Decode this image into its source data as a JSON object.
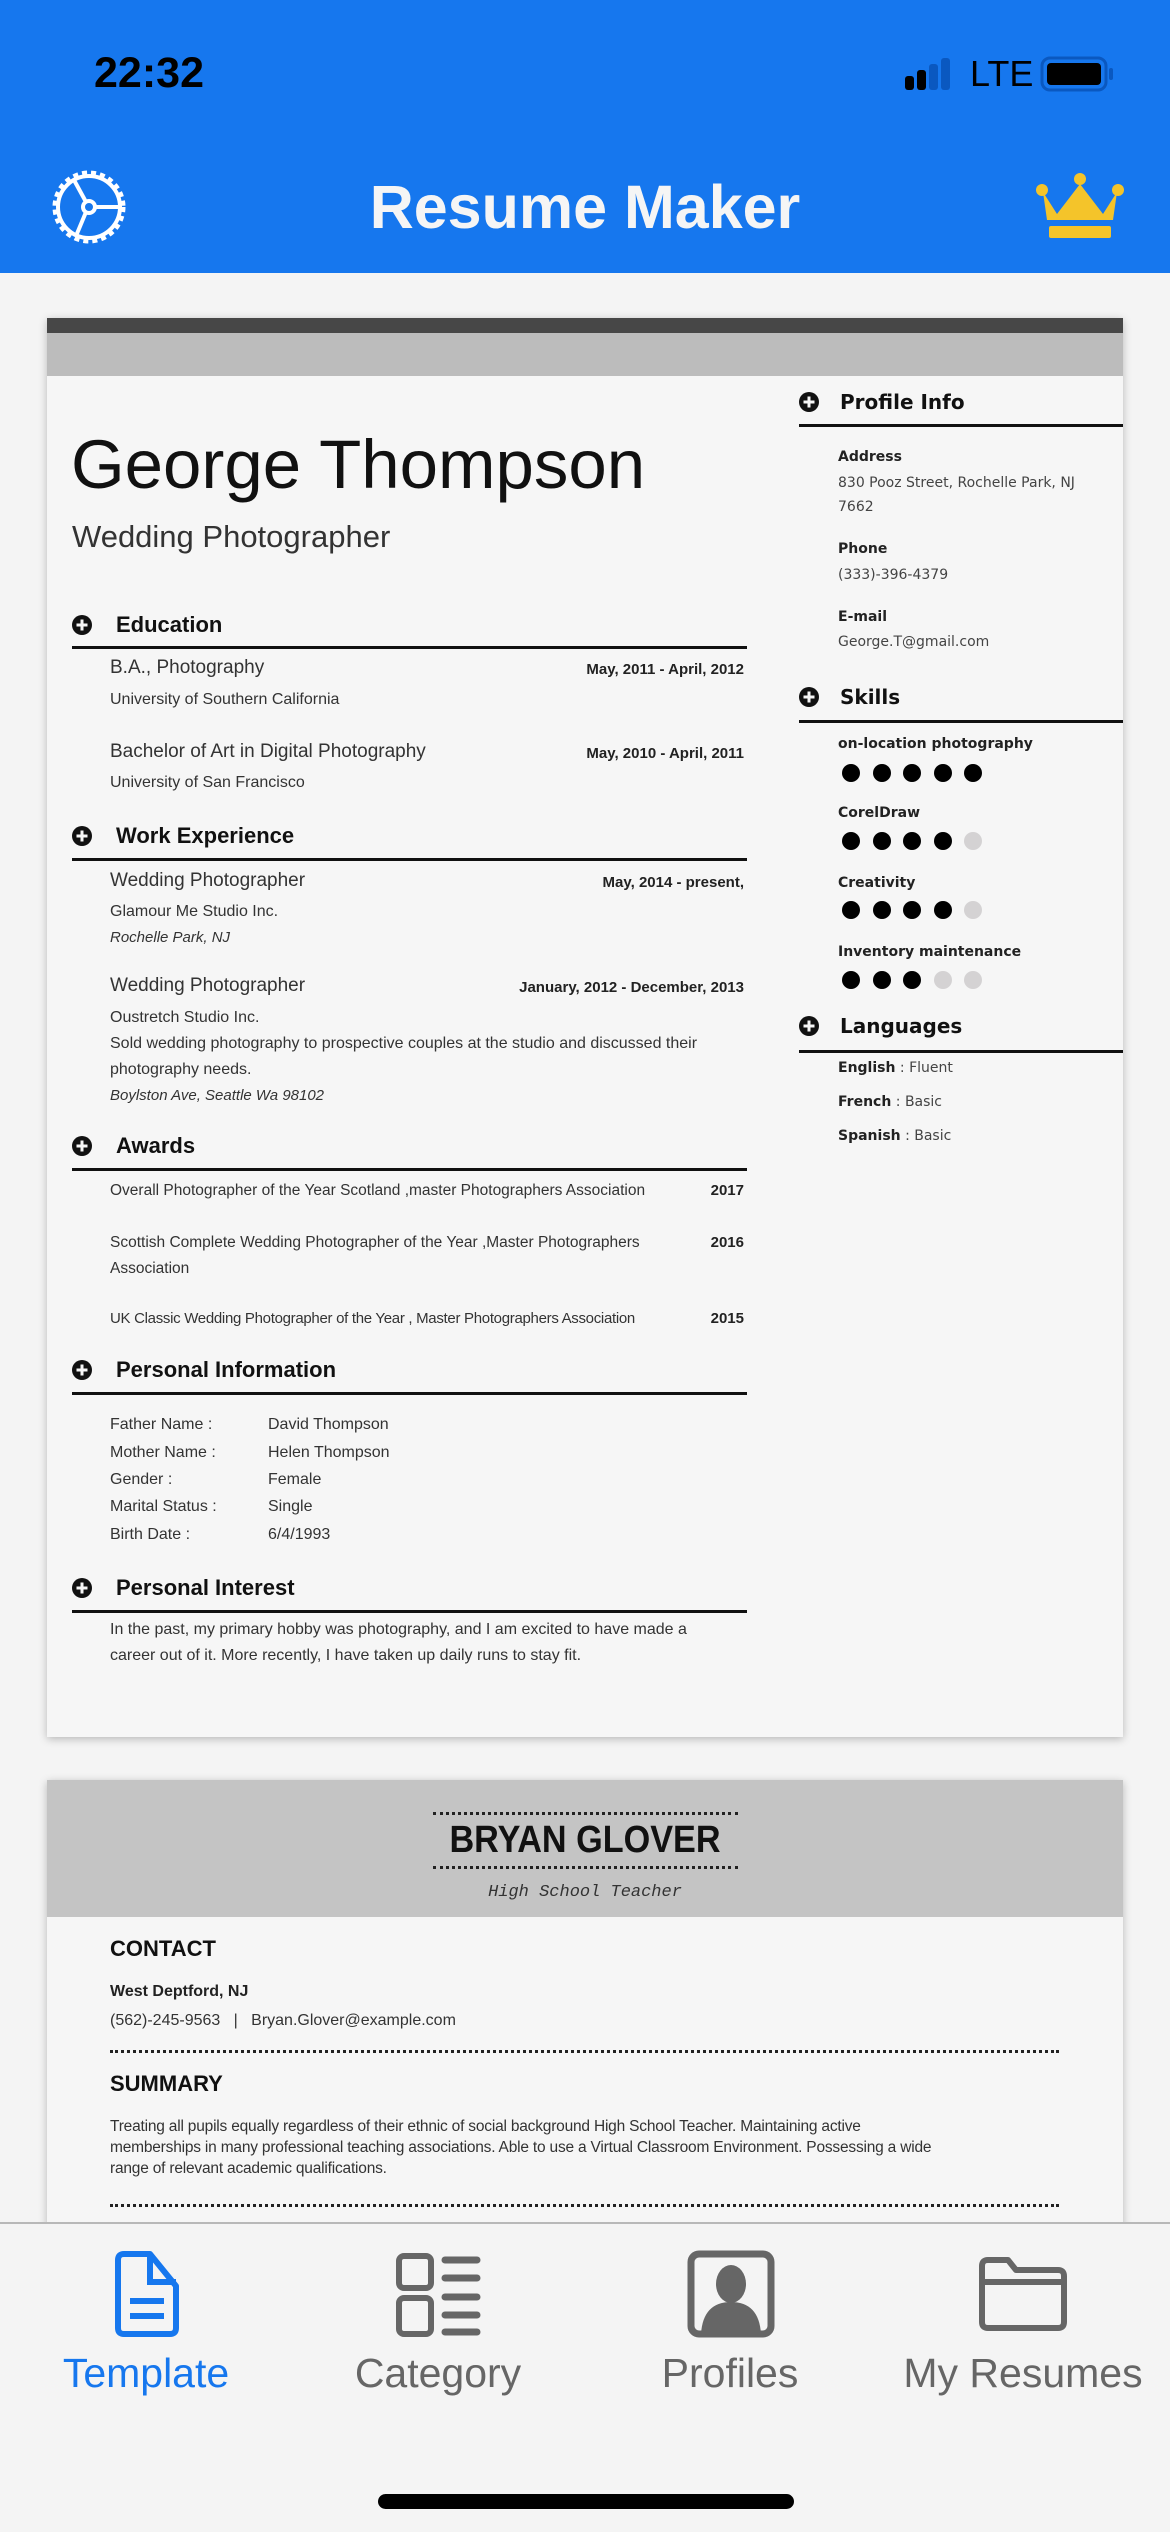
{
  "status_bar": {
    "time": "22:32",
    "network": "LTE"
  },
  "header": {
    "title": "Resume Maker",
    "settings_icon": "gear-icon",
    "premium_icon": "crown-icon",
    "color": "#1677ee",
    "crown_color": "#f4c42a"
  },
  "resume1": {
    "name": "George Thompson",
    "role": "Wedding Photographer",
    "education": {
      "heading": "Education",
      "items": [
        {
          "title": "B.A., Photography",
          "school": "University of Southern California",
          "dates": "May, 2011 - April, 2012"
        },
        {
          "title": "Bachelor of Art in Digital Photography",
          "school": "University of San Francisco",
          "dates": "May, 2010 - April, 2011"
        }
      ]
    },
    "work": {
      "heading": "Work Experience",
      "items": [
        {
          "title": "Wedding Photographer",
          "company": "Glamour Me Studio Inc.",
          "location": "Rochelle Park, NJ",
          "dates": "May, 2014 - present,"
        },
        {
          "title": "Wedding Photographer",
          "company": "Oustretch Studio Inc.",
          "desc1": "Sold wedding photography to prospective couples at the studio and discussed their",
          "desc2": "photography needs.",
          "location": "Boylston Ave, Seattle Wa 98102",
          "dates": "January, 2012 - December, 2013"
        }
      ]
    },
    "awards": {
      "heading": "Awards",
      "items": [
        {
          "line1": "Overall Photographer of the Year Scotland ,master Photographers Association",
          "year": "2017"
        },
        {
          "line1": "Scottish Complete Wedding Photographer of the Year ,Master Photographers",
          "line2": "Association",
          "year": "2016"
        },
        {
          "line1": "UK Classic Wedding Photographer of the Year , Master Photographers Association",
          "year": "2015"
        }
      ]
    },
    "personal": {
      "heading": "Personal Information",
      "rows": [
        {
          "label": "Father Name :",
          "value": "David Thompson"
        },
        {
          "label": "Mother Name :",
          "value": "Helen Thompson"
        },
        {
          "label": "Gender :",
          "value": "Female"
        },
        {
          "label": "Marital Status :",
          "value": "Single"
        },
        {
          "label": "Birth Date :",
          "value": "6/4/1993"
        }
      ]
    },
    "interest": {
      "heading": "Personal Interest",
      "line1": "In the past, my primary hobby was photography, and I am excited to have made a",
      "line2": "career out of it. More recently, I have taken up daily runs to stay fit."
    },
    "profile": {
      "heading": "Profile Info",
      "address_label": "Address",
      "address1": "830 Pooz Street, Rochelle Park, NJ",
      "address2": "7662",
      "phone_label": "Phone",
      "phone": "(333)-396-4379",
      "email_label": "E-mail",
      "email": "George.T@gmail.com"
    },
    "skills": {
      "heading": "Skills",
      "max": 5,
      "items": [
        {
          "name": "on-location photography",
          "level": 5
        },
        {
          "name": "CorelDraw",
          "level": 4
        },
        {
          "name": "Creativity",
          "level": 4
        },
        {
          "name": "Inventory maintenance",
          "level": 3
        }
      ]
    },
    "languages": {
      "heading": "Languages",
      "items": [
        {
          "name": "English",
          "sep": " : ",
          "level": "Fluent"
        },
        {
          "name": "French",
          "sep": " : ",
          "level": "Basic"
        },
        {
          "name": "Spanish",
          "sep": " : ",
          "level": "Basic"
        }
      ]
    }
  },
  "resume2": {
    "name": "BRYAN GLOVER",
    "role": "High School Teacher",
    "contact_heading": "CONTACT",
    "location": "West Deptford, NJ",
    "phone": "(562)-245-9563",
    "sep": "|",
    "email": "Bryan.Glover@example.com",
    "summary_heading": "SUMMARY",
    "summary1": "Treating all pupils equally regardless of their ethnic of social background High School Teacher. Maintaining active",
    "summary2": "memberships in many professional teaching associations. Able to use a Virtual Classroom Environment. Possessing a wide",
    "summary3": "range of relevant academic qualifications."
  },
  "nav": {
    "active_color": "#1677ee",
    "items": [
      {
        "label": "Template",
        "icon": "document-icon",
        "active": true
      },
      {
        "label": "Category",
        "icon": "category-list-icon",
        "active": false
      },
      {
        "label": "Profiles",
        "icon": "profile-icon",
        "active": false
      },
      {
        "label": "My Resumes",
        "icon": "folder-icon",
        "active": false
      }
    ]
  }
}
